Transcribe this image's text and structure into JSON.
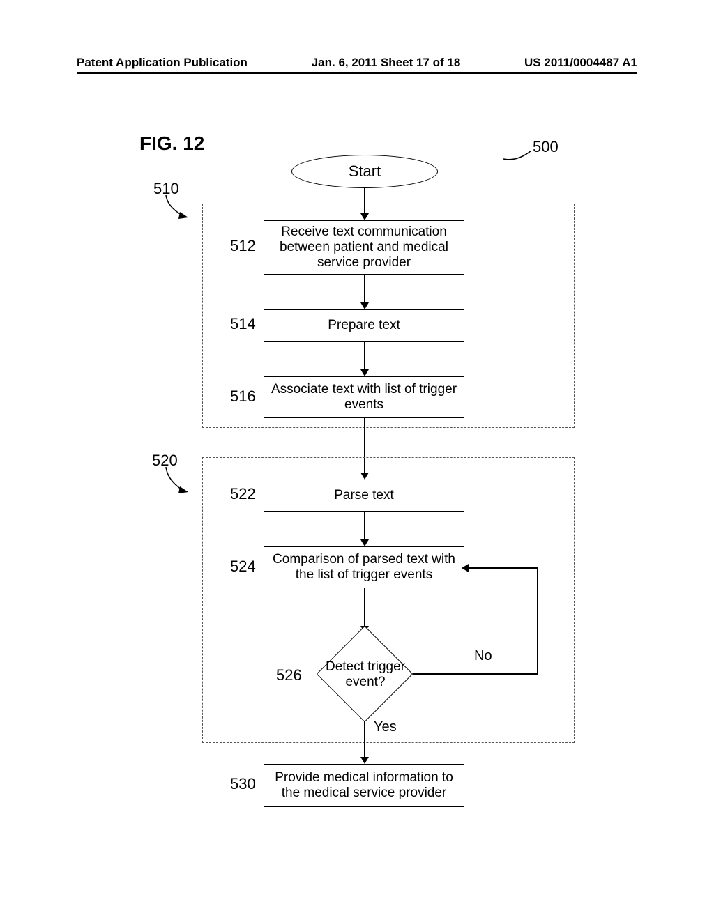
{
  "header": {
    "left": "Patent Application Publication",
    "center": "Jan. 6, 2011   Sheet 17 of 18",
    "right": "US 2011/0004487 A1"
  },
  "figure_label": "FIG. 12",
  "refs": {
    "r500": "500",
    "r510": "510",
    "r512": "512",
    "r514": "514",
    "r516": "516",
    "r520": "520",
    "r522": "522",
    "r524": "524",
    "r526": "526",
    "r530": "530"
  },
  "steps": {
    "start": "Start",
    "s512": "Receive text communication between patient and medical service provider",
    "s514": "Prepare text",
    "s516": "Associate text with list of trigger events",
    "s522": "Parse text",
    "s524": "Comparison of parsed text with the list of trigger events",
    "s526": "Detect trigger event?",
    "s530": "Provide medical information to the medical service provider"
  },
  "branches": {
    "yes": "Yes",
    "no": "No"
  }
}
